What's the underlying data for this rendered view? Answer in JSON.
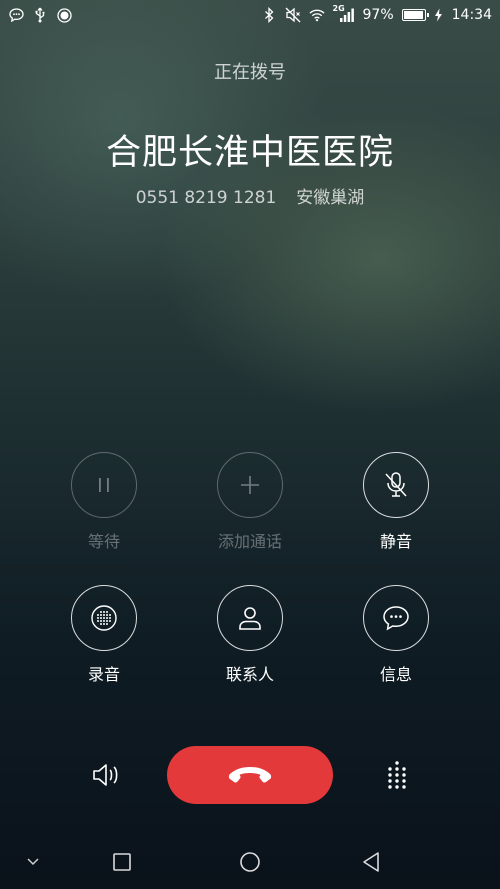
{
  "status_bar": {
    "left_icons": [
      "chat-bubble-icon",
      "usb-icon",
      "record-dot-icon"
    ],
    "right_icons": [
      "bluetooth-icon",
      "vibrate-mute-icon",
      "wifi-icon",
      "signal-icon",
      "battery-icon",
      "charging-icon"
    ],
    "network_label": "2G",
    "battery_text": "97%",
    "battery_level": 0.97,
    "time": "14:34"
  },
  "call": {
    "status": "正在拨号",
    "name": "合肥长淮中医医院",
    "number": "0551 8219 1281",
    "location": "安徽巢湖"
  },
  "controls": {
    "hold": {
      "label": "等待",
      "icon": "pause-icon",
      "enabled": false
    },
    "add_call": {
      "label": "添加通话",
      "icon": "plus-icon",
      "enabled": false
    },
    "mute": {
      "label": "静音",
      "icon": "mic-off-icon",
      "enabled": true
    },
    "record": {
      "label": "录音",
      "icon": "record-icon",
      "enabled": true
    },
    "contacts": {
      "label": "联系人",
      "icon": "contact-icon",
      "enabled": true
    },
    "message": {
      "label": "信息",
      "icon": "message-icon",
      "enabled": true
    }
  },
  "bottom": {
    "speaker_icon": "speaker-icon",
    "end_call_icon": "hang-up-icon",
    "dialpad_icon": "dialpad-icon",
    "end_call_color": "#e3393a"
  },
  "navbar": [
    "collapse-icon",
    "recents-icon",
    "home-icon",
    "back-icon"
  ]
}
